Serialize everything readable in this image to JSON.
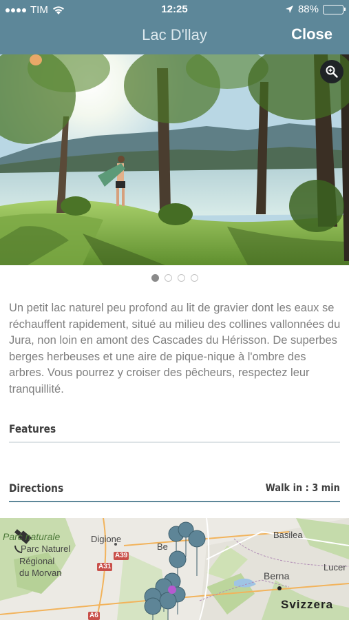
{
  "status_bar": {
    "carrier": "TIM",
    "time": "12:25",
    "battery": "88%",
    "battery_level": 0.88
  },
  "header": {
    "title": "Lac D'llay",
    "close_label": "Close"
  },
  "gallery": {
    "image_count": 4,
    "active_index": 0
  },
  "description": "Un petit lac naturel peu profond au lit de gravier dont les eaux se réchauffent rapidement, situé au milieu des collines vallonnées du Jura, non loin en amont des Cascades du Hérisson. De superbes berges herbeuses et une aire de pique-nique à l'ombre des arbres. Vous pourrez y croiser des pêcheurs, respectez leur tranquillité.",
  "sections": {
    "features": {
      "label": "Features"
    },
    "directions": {
      "label": "Directions",
      "walk_time": "Walk in : 3 min"
    }
  },
  "map": {
    "labels": {
      "parc_line1": "Parc naturale",
      "parc_line2": "Parc Naturel",
      "parc_line3": "Régional",
      "parc_line4": "du Morvan",
      "dijon": "Digione",
      "basel": "Basilea",
      "bern": "Berna",
      "lucerne": "Lucer",
      "switzerland": "Svizzera",
      "be": "Be",
      "a39": "A39",
      "a31": "A31",
      "a6": "A6"
    }
  },
  "colors": {
    "header_bg": "#5d8799",
    "title_text": "#dde9ee",
    "divider_active": "#5d8799",
    "pin": "#5e8597"
  }
}
